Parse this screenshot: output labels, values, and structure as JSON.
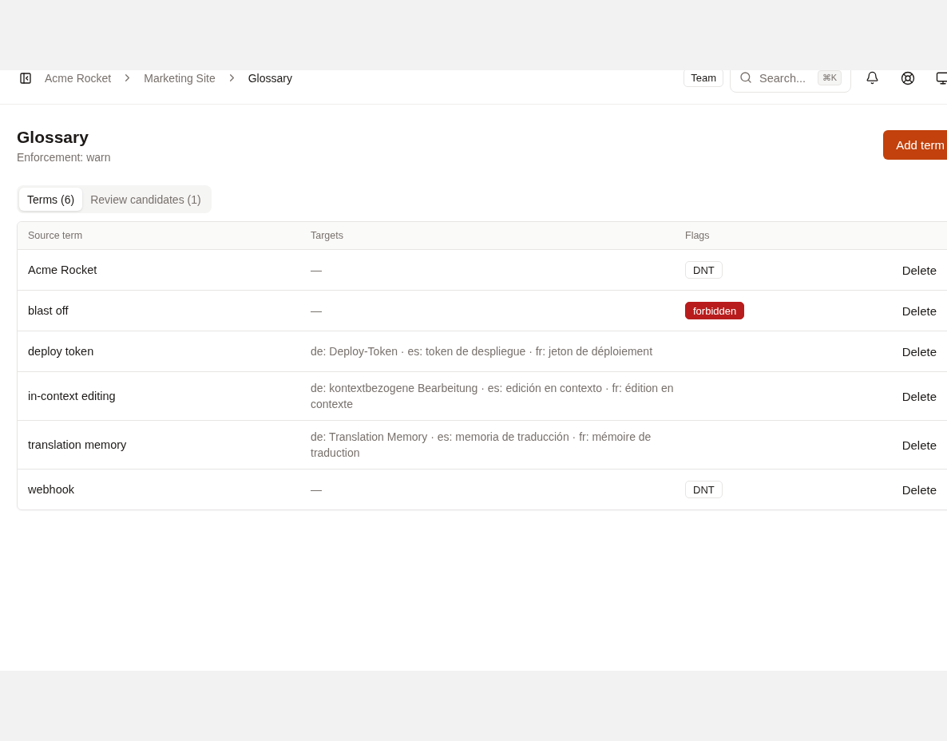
{
  "breadcrumb": [
    {
      "label": "Acme Rocket",
      "current": false
    },
    {
      "label": "Marketing Site",
      "current": false
    },
    {
      "label": "Glossary",
      "current": true
    }
  ],
  "header_actions": {
    "team_button": "Team",
    "search": {
      "placeholder": "Search...",
      "shortcut": "⌘K"
    }
  },
  "page": {
    "title": "Glossary",
    "subtitle": "Enforcement: warn",
    "add_button": "Add term"
  },
  "tabs": [
    {
      "label": "Terms (6)",
      "selected": true
    },
    {
      "label": "Review candidates (1)",
      "selected": false
    }
  ],
  "table": {
    "columns": [
      "Source term",
      "Targets",
      "Flags"
    ],
    "rows": [
      {
        "source": "Acme Rocket",
        "targets": "—",
        "flags": [
          {
            "label": "DNT",
            "kind": "dnt"
          }
        ],
        "action": "Delete"
      },
      {
        "source": "blast off",
        "targets": "—",
        "flags": [
          {
            "label": "forbidden",
            "kind": "forbidden"
          }
        ],
        "action": "Delete"
      },
      {
        "source": "deploy token",
        "targets": "de: Deploy-Token · es: token de despliegue · fr: jeton de déploiement",
        "action": "Delete"
      },
      {
        "source": "in-context editing",
        "targets": "de: kontextbezogene Bearbeitung · es: edición en contexto · fr: édition en contexte",
        "action": "Delete"
      },
      {
        "source": "translation memory",
        "targets": "de: Translation Memory · es: memoria de traducción · fr: mémoire de traduction",
        "action": "Delete"
      },
      {
        "source": "webhook",
        "targets": "—",
        "flags": [
          {
            "label": "DNT",
            "kind": "dnt"
          }
        ],
        "action": "Delete"
      }
    ]
  }
}
